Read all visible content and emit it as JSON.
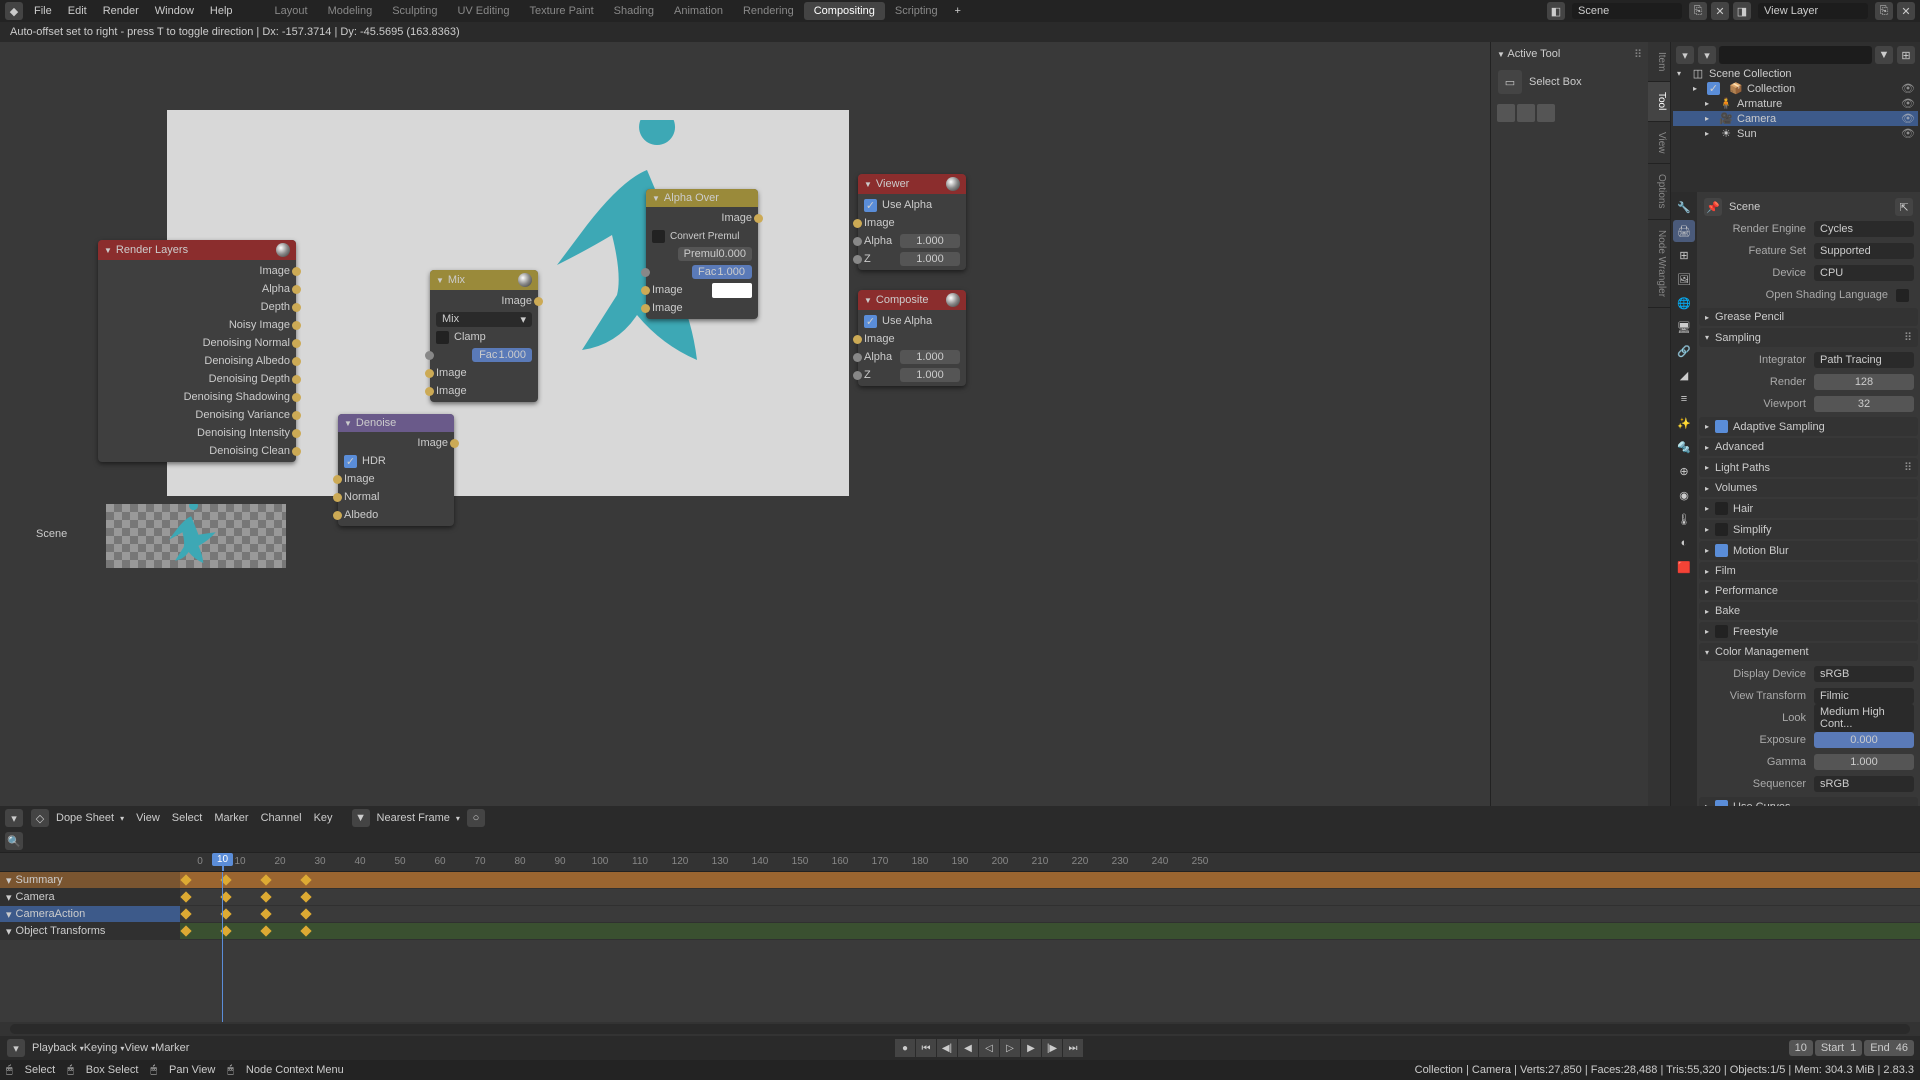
{
  "topbar": {
    "menus": [
      "File",
      "Edit",
      "Render",
      "Window",
      "Help"
    ],
    "workspaces": [
      "Layout",
      "Modeling",
      "Sculpting",
      "UV Editing",
      "Texture Paint",
      "Shading",
      "Animation",
      "Rendering",
      "Compositing",
      "Scripting"
    ],
    "active_workspace": "Compositing",
    "scene_field": "Scene",
    "viewlayer_field": "View Layer"
  },
  "status_msg": "Auto-offset set to right - press T to toggle direction  |  Dx: -157.3714  |  Dy: -45.5695 (163.8363)",
  "sidepanel": {
    "title": "Active Tool",
    "tool": "Select Box",
    "tabs": [
      "Item",
      "Tool",
      "View",
      "Options",
      "Node Wrangler"
    ]
  },
  "nodes": {
    "render_layers": {
      "title": "Render Layers",
      "outputs": [
        "Image",
        "Alpha",
        "Depth",
        "Noisy Image",
        "Denoising Normal",
        "Denoising Albedo",
        "Denoising Depth",
        "Denoising Shadowing",
        "Denoising Variance",
        "Denoising Intensity",
        "Denoising Clean"
      ]
    },
    "denoise": {
      "title": "Denoise",
      "out": "Image",
      "hdr_label": "HDR",
      "inputs": [
        "Image",
        "Normal",
        "Albedo"
      ]
    },
    "mix": {
      "title": "Mix",
      "out": "Image",
      "mode": "Mix",
      "clamp": "Clamp",
      "fac_label": "Fac",
      "fac_val": "1.000",
      "in1": "Image",
      "in2": "Image"
    },
    "alphaover": {
      "title": "Alpha Over",
      "out": "Image",
      "conv": "Convert Premul",
      "premul_label": "Premul",
      "premul_val": "0.000",
      "fac_label": "Fac",
      "fac_val": "1.000",
      "in1": "Image",
      "in2": "Image"
    },
    "viewer": {
      "title": "Viewer",
      "usealpha": "Use Alpha",
      "in_image": "Image",
      "alpha_l": "Alpha",
      "alpha_v": "1.000",
      "z_l": "Z",
      "z_v": "1.000"
    },
    "composite": {
      "title": "Composite",
      "usealpha": "Use Alpha",
      "in_image": "Image",
      "alpha_l": "Alpha",
      "alpha_v": "1.000",
      "z_l": "Z",
      "z_v": "1.000"
    }
  },
  "preview_label": "Scene",
  "outliner": {
    "root": "Scene Collection",
    "items": [
      {
        "name": "Collection",
        "icon": "📦",
        "indent": 1,
        "checked": true
      },
      {
        "name": "Armature",
        "icon": "🧍",
        "indent": 2
      },
      {
        "name": "Camera",
        "icon": "🎥",
        "indent": 2,
        "selected": true
      },
      {
        "name": "Sun",
        "icon": "☀",
        "indent": 2
      }
    ]
  },
  "props": {
    "pin_label": "Scene",
    "render_engine": {
      "l": "Render Engine",
      "v": "Cycles"
    },
    "feature_set": {
      "l": "Feature Set",
      "v": "Supported"
    },
    "device": {
      "l": "Device",
      "v": "CPU"
    },
    "osl": "Open Shading Language",
    "sections1": [
      "Grease Pencil"
    ],
    "sampling": {
      "title": "Sampling",
      "integrator_l": "Integrator",
      "integrator_v": "Path Tracing",
      "render_l": "Render",
      "render_v": "128",
      "viewport_l": "Viewport",
      "viewport_v": "32",
      "adaptive": "Adaptive Sampling",
      "advanced": "Advanced"
    },
    "sections2": [
      "Light Paths",
      "Volumes",
      "Hair",
      "Simplify",
      "Motion Blur",
      "Film",
      "Performance",
      "Bake",
      "Freestyle"
    ],
    "colormgmt": {
      "title": "Color Management",
      "display_l": "Display Device",
      "display_v": "sRGB",
      "vt_l": "View Transform",
      "vt_v": "Filmic",
      "look_l": "Look",
      "look_v": "Medium High Cont...",
      "exp_l": "Exposure",
      "exp_v": "0.000",
      "gamma_l": "Gamma",
      "gamma_v": "1.000",
      "seq_l": "Sequencer",
      "seq_v": "sRGB",
      "curves": "Use Curves"
    }
  },
  "dopesheet": {
    "mode": "Dope Sheet",
    "menus": [
      "View",
      "Select",
      "Marker",
      "Channel",
      "Key"
    ],
    "nearest": "Nearest Frame",
    "frames": [
      "0",
      "10",
      "20",
      "30",
      "40",
      "50",
      "60",
      "70",
      "80",
      "90",
      "100",
      "110",
      "120",
      "130",
      "140",
      "150",
      "160",
      "170",
      "180",
      "190",
      "200",
      "210",
      "220",
      "230",
      "240",
      "250"
    ],
    "current_frame": "10",
    "tracks": [
      {
        "name": "Summary",
        "type": "summary",
        "kf": [
          0,
          10,
          20,
          30
        ]
      },
      {
        "name": "Camera",
        "type": "obj",
        "kf": [
          0,
          10,
          20,
          30
        ]
      },
      {
        "name": "CameraAction",
        "type": "action",
        "sel": true,
        "kf": [
          0,
          10,
          20,
          30
        ]
      },
      {
        "name": "Object Transforms",
        "type": "group",
        "kf": [
          0,
          10,
          20,
          30
        ]
      }
    ]
  },
  "timeline": {
    "menus": [
      "Playback",
      "Keying",
      "View",
      "Marker"
    ],
    "current": "10",
    "start_l": "Start",
    "start_v": "1",
    "end_l": "End",
    "end_v": "46"
  },
  "footer": {
    "left": [
      "Select",
      "Box Select",
      "Pan View",
      "Node Context Menu"
    ],
    "right": "Collection | Camera | Verts:27,850 | Faces:28,488 | Tris:55,320 | Objects:1/5 | Mem: 304.3 MiB | 2.83.3"
  }
}
